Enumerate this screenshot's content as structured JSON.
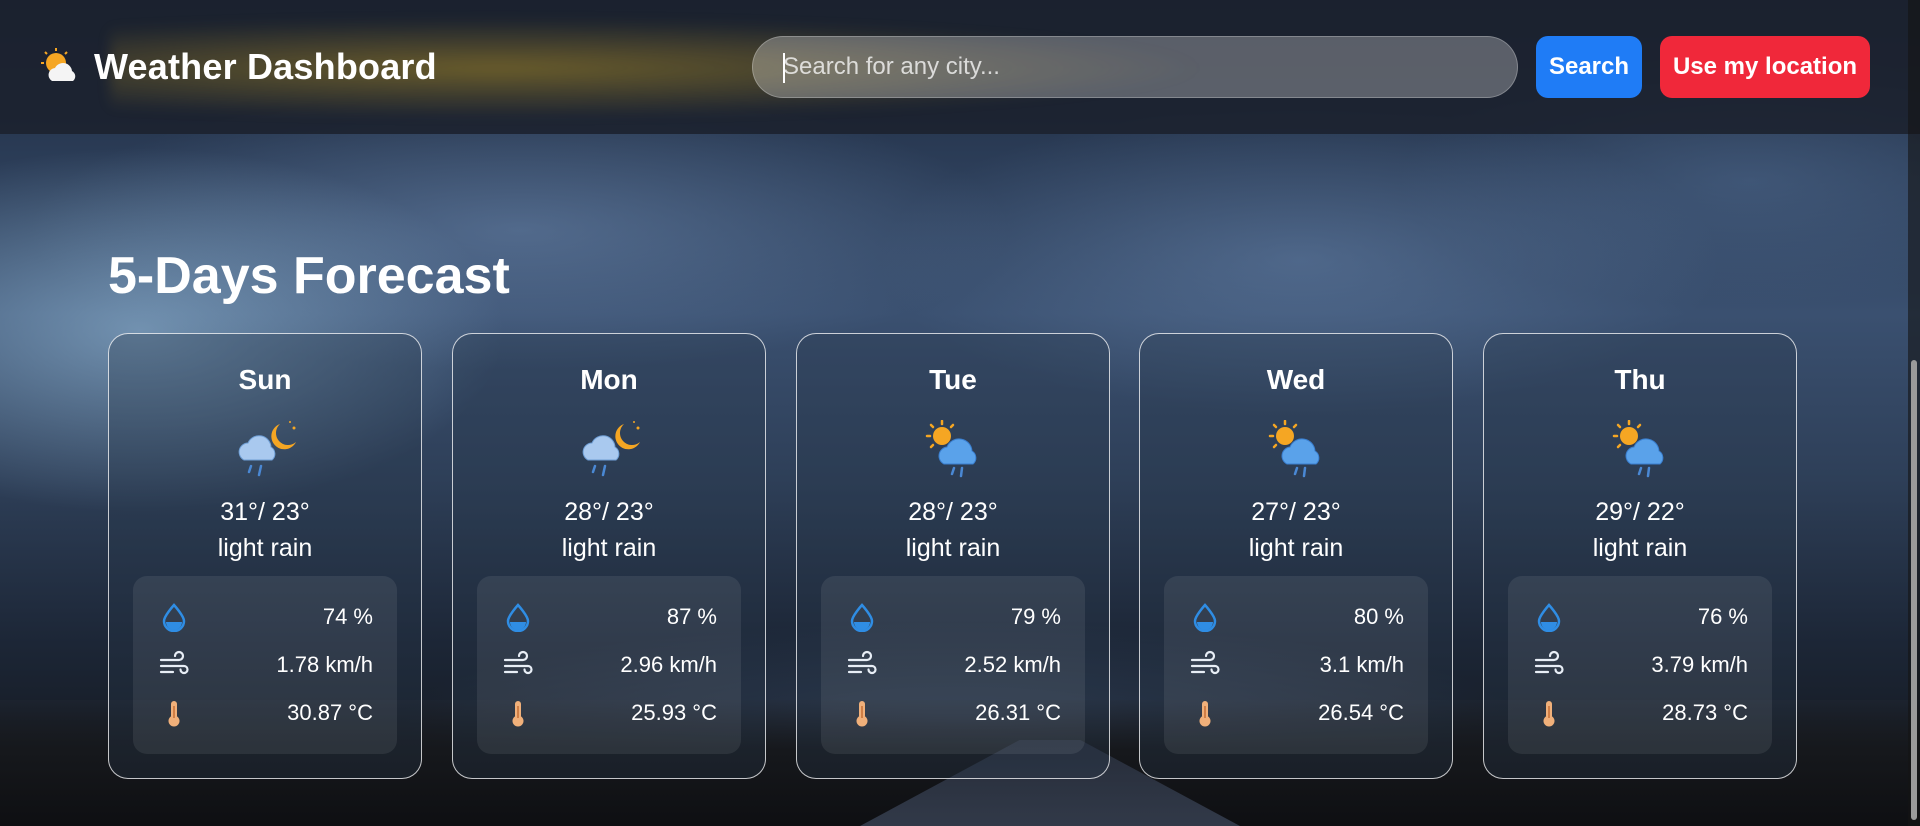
{
  "app": {
    "title": "Weather Dashboard",
    "icon": "sun-cloud-icon"
  },
  "search": {
    "placeholder": "Search for any city...",
    "value": "",
    "search_label": "Search",
    "location_label": "Use my location"
  },
  "colors": {
    "search_button": "#1f7cf6",
    "location_button": "#f0283a",
    "humidity_icon": "#2f8de4",
    "thermometer_icon": "#f0b07a"
  },
  "forecast": {
    "title": "5-Days Forecast",
    "days": [
      {
        "day": "Sun",
        "icon": "moon-cloud-rain-icon",
        "temps": "31°/ 23°",
        "condition": "light rain",
        "humidity": "74 %",
        "wind": "1.78 km/h",
        "temp": "30.87 °C"
      },
      {
        "day": "Mon",
        "icon": "moon-cloud-rain-icon",
        "temps": "28°/ 23°",
        "condition": "light rain",
        "humidity": "87 %",
        "wind": "2.96 km/h",
        "temp": "25.93 °C"
      },
      {
        "day": "Tue",
        "icon": "sun-cloud-rain-icon",
        "temps": "28°/ 23°",
        "condition": "light rain",
        "humidity": "79 %",
        "wind": "2.52 km/h",
        "temp": "26.31 °C"
      },
      {
        "day": "Wed",
        "icon": "sun-cloud-rain-icon",
        "temps": "27°/ 23°",
        "condition": "light rain",
        "humidity": "80 %",
        "wind": "3.1 km/h",
        "temp": "26.54 °C"
      },
      {
        "day": "Thu",
        "icon": "sun-cloud-rain-icon",
        "temps": "29°/ 22°",
        "condition": "light rain",
        "humidity": "76 %",
        "wind": "3.79 km/h",
        "temp": "28.73 °C"
      }
    ]
  }
}
